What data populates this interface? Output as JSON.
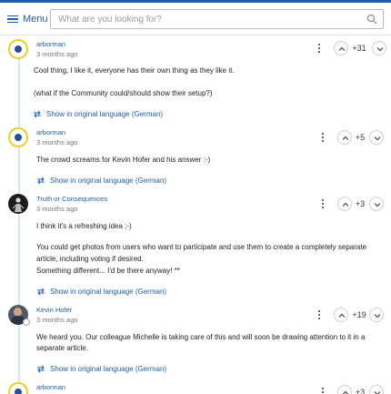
{
  "header": {
    "menu_label": "Menu",
    "search_placeholder": "What are you looking for?"
  },
  "comments": [
    {
      "author": "arborman",
      "time": "3 months ago",
      "score": "+31",
      "paragraphs": [
        "Cool thing, I like it, everyone has their own thing as they like it.",
        "(what if the Community could/should show their setup?)"
      ],
      "translate_label": "Show in original language (German)"
    },
    {
      "author": "arborman",
      "time": "3 months ago",
      "score": "+5",
      "paragraphs": [
        "The crowd screams for Kevin Hofer and his answer :-)"
      ],
      "translate_label": "Show in original language (German)"
    },
    {
      "author": "Truth or Consequences",
      "time": "3 months ago",
      "score": "+3",
      "paragraphs": [
        "I think it's a refreshing idea ;-)",
        "You could get photos from users who want to participate and use them to create a completely separate",
        "article, including voting if desired.",
        "Something different... I'd be there anyway! **"
      ],
      "translate_label": "Show in original language (German)"
    },
    {
      "author": "Kevin Hofer",
      "time": "3 months ago",
      "score": "+19",
      "paragraphs": [
        "We heard you. Our colleague Michelle is taking care of this and will soon be drawing attention to it in a",
        "separate article."
      ],
      "translate_label": "Show in original language (German)"
    },
    {
      "author": "arborman",
      "time": "",
      "score": "+3",
      "paragraphs": [],
      "translate_label": ""
    }
  ]
}
